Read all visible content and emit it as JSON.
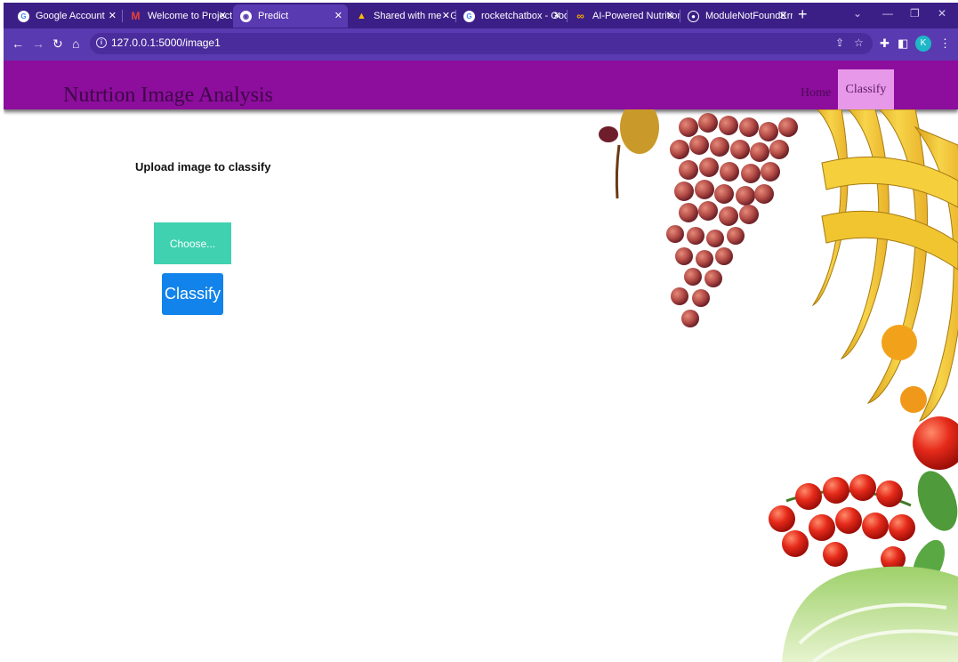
{
  "browser": {
    "tabs": [
      {
        "label": "Google Account",
        "icon": "google-icon",
        "active": false
      },
      {
        "label": "Welcome to ProjectI",
        "icon": "gmail-icon",
        "active": false
      },
      {
        "label": "Predict",
        "icon": "chrome-icon",
        "active": true
      },
      {
        "label": "Shared with me - Goo",
        "icon": "drive-icon",
        "active": false
      },
      {
        "label": "rocketchatbox - Goog",
        "icon": "google-icon",
        "active": false
      },
      {
        "label": "AI-Powered Nutrition",
        "icon": "colab-icon",
        "active": false
      },
      {
        "label": "ModuleNotFoundErr",
        "icon": "github-icon",
        "active": false
      }
    ],
    "url": "127.0.0.1:5000/image1",
    "profile_initial": "K",
    "colors": {
      "tabstrip": "#3b1f86",
      "toolbar": "#5a3ab0",
      "omnibox": "#4a2c9c"
    }
  },
  "page": {
    "site_title": "Nutrtion Image Analysis",
    "nav": {
      "home": "Home",
      "classify": "Classify"
    },
    "upload_label": "Upload image to classify",
    "choose_button": "Choose...",
    "classify_button": "Classify",
    "colors": {
      "navbar": "#8d0d9d",
      "active_nav": "#e898e9",
      "choose": "#3fd1b0",
      "classify": "#1283ea"
    }
  }
}
